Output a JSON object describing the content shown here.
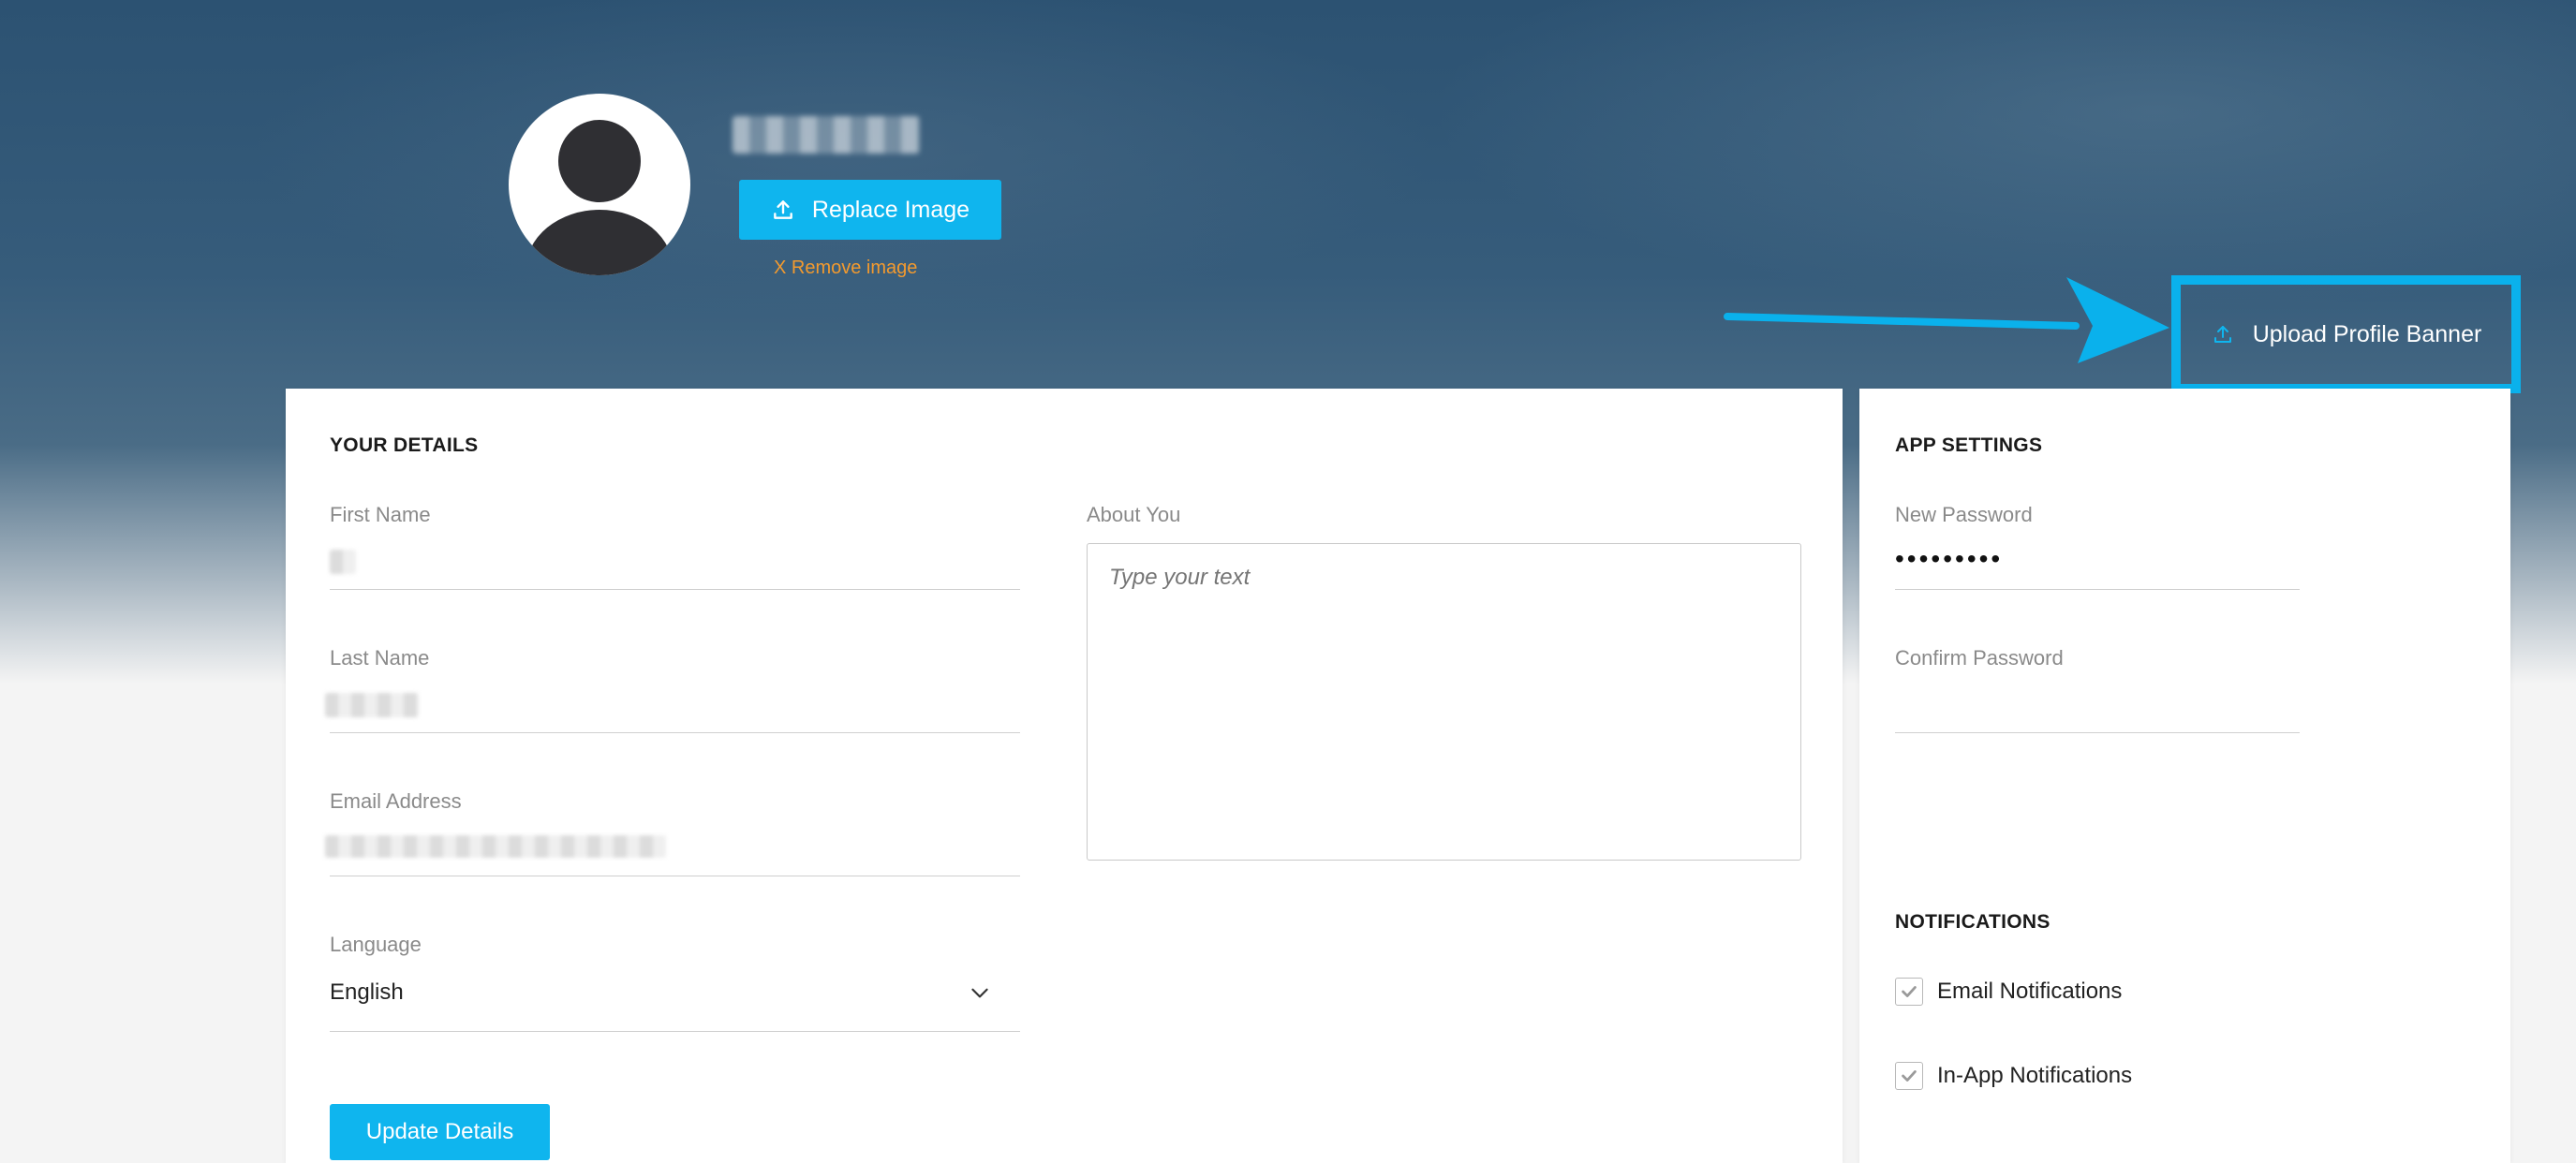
{
  "profile": {
    "replace_image_label": "Replace Image",
    "remove_image_label": "X Remove image",
    "upload_banner_label": "Upload Profile Banner"
  },
  "details": {
    "section_title": "YOUR DETAILS",
    "first_name": {
      "label": "First Name"
    },
    "last_name": {
      "label": "Last Name"
    },
    "email": {
      "label": "Email Address"
    },
    "about": {
      "label": "About You",
      "placeholder": "Type your text"
    },
    "language": {
      "label": "Language",
      "selected": "English"
    },
    "update_button_label": "Update Details"
  },
  "settings": {
    "section_title": "APP SETTINGS",
    "new_password": {
      "label": "New Password",
      "value": "•••••••••"
    },
    "confirm_password": {
      "label": "Confirm Password"
    },
    "notifications_title": "NOTIFICATIONS",
    "notifications": [
      {
        "label": "Email Notifications",
        "checked": true
      },
      {
        "label": "In-App Notifications",
        "checked": true
      }
    ]
  },
  "colors": {
    "accent": "#0fb5ee",
    "remove_link": "#f39a2e",
    "banner_dark": "#2c5272"
  },
  "icons": [
    "upload-icon",
    "chevron-down-icon",
    "check-icon",
    "arrow-annotation"
  ]
}
